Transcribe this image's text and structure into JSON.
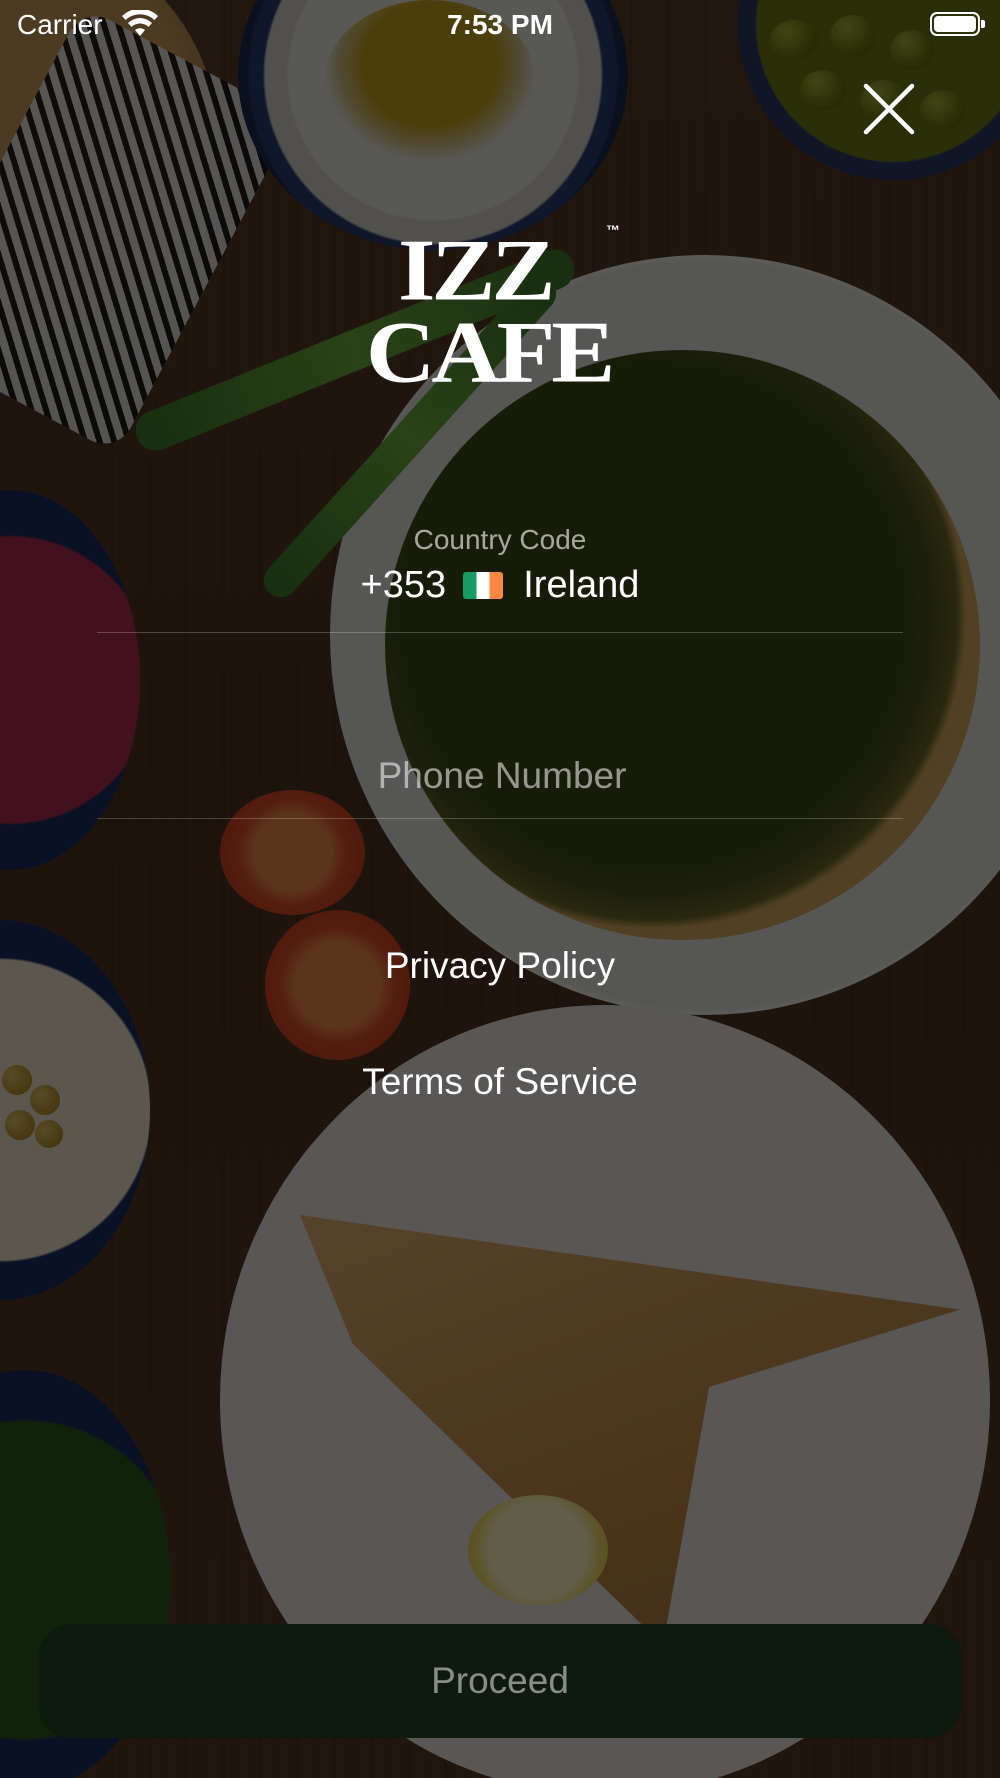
{
  "status_bar": {
    "carrier": "Carrier",
    "time": "7:53 PM",
    "wifi_icon": "wifi-icon",
    "battery_icon": "battery-full-icon"
  },
  "close": {
    "icon": "close-icon"
  },
  "logo": {
    "line1": "IZZ",
    "line2": "CAFE",
    "trademark": "™"
  },
  "form": {
    "country_code_label": "Country Code",
    "country_code_value": "+353",
    "country_flag_icon": "ireland-flag-icon",
    "country_name": "Ireland",
    "phone_placeholder": "Phone Number",
    "phone_value": ""
  },
  "links": {
    "privacy_policy": "Privacy Policy",
    "terms_of_service": "Terms of Service"
  },
  "actions": {
    "proceed_label": "Proceed"
  },
  "colors": {
    "proceed_background": "#0e1a0e",
    "overlay": "rgba(0,0,0,0.62)",
    "text_primary": "#ffffff"
  }
}
